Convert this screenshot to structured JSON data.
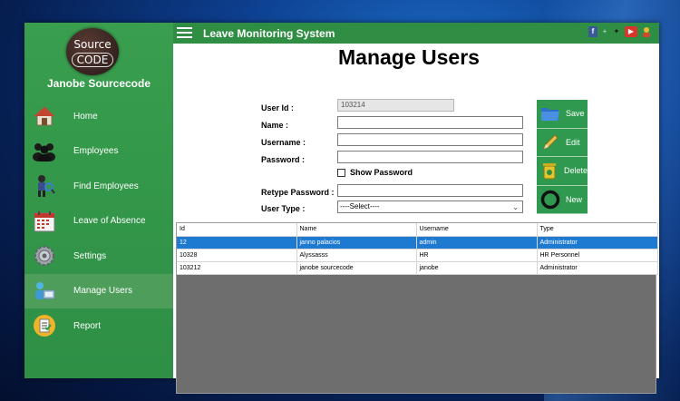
{
  "app": {
    "title": "Leave Monitoring System",
    "brand_name": "Janobe Sourcecode",
    "logo_line1": "Source",
    "logo_line2": "CODE"
  },
  "sidebar": {
    "items": [
      {
        "label": "Home",
        "icon": "home-icon"
      },
      {
        "label": "Employees",
        "icon": "employees-icon"
      },
      {
        "label": "Find Employees",
        "icon": "find-employees-icon"
      },
      {
        "label": "Leave of Absence",
        "icon": "calendar-icon"
      },
      {
        "label": "Settings",
        "icon": "settings-gear-icon"
      },
      {
        "label": "Manage Users",
        "icon": "manage-users-icon",
        "active": true
      },
      {
        "label": "Report",
        "icon": "report-icon"
      }
    ]
  },
  "main": {
    "page_title": "Manage Users",
    "form": {
      "user_id_label": "User Id :",
      "user_id_value": "103214",
      "name_label": "Name :",
      "name_value": "",
      "username_label": "Username :",
      "username_value": "",
      "password_label": "Password :",
      "password_value": "",
      "show_password_label": "Show Password",
      "retype_password_label": "Retype Password :",
      "retype_password_value": "",
      "user_type_label": "User Type :",
      "user_type_value": "----Select----"
    },
    "buttons": {
      "save": "Save",
      "edit": "Edit",
      "delete": "Delete",
      "new": "New"
    },
    "grid": {
      "columns": [
        "Id",
        "Name",
        "Username",
        "Type"
      ],
      "rows": [
        {
          "id": "12",
          "name": "janno palacios",
          "username": "admin",
          "type": "Administrator",
          "selected": true
        },
        {
          "id": "10328",
          "name": "Alyssasss",
          "username": "HR",
          "type": "HR Personnel"
        },
        {
          "id": "103212",
          "name": "janobe sourcecode",
          "username": "janobe",
          "type": "Administrator"
        }
      ]
    }
  },
  "colors": {
    "sidebar_green": "#34984a",
    "topbar_green": "#2f8e43",
    "button_green": "#2f9a4f",
    "selection_blue": "#1e7ad1",
    "grid_background": "#6e6e6e"
  }
}
